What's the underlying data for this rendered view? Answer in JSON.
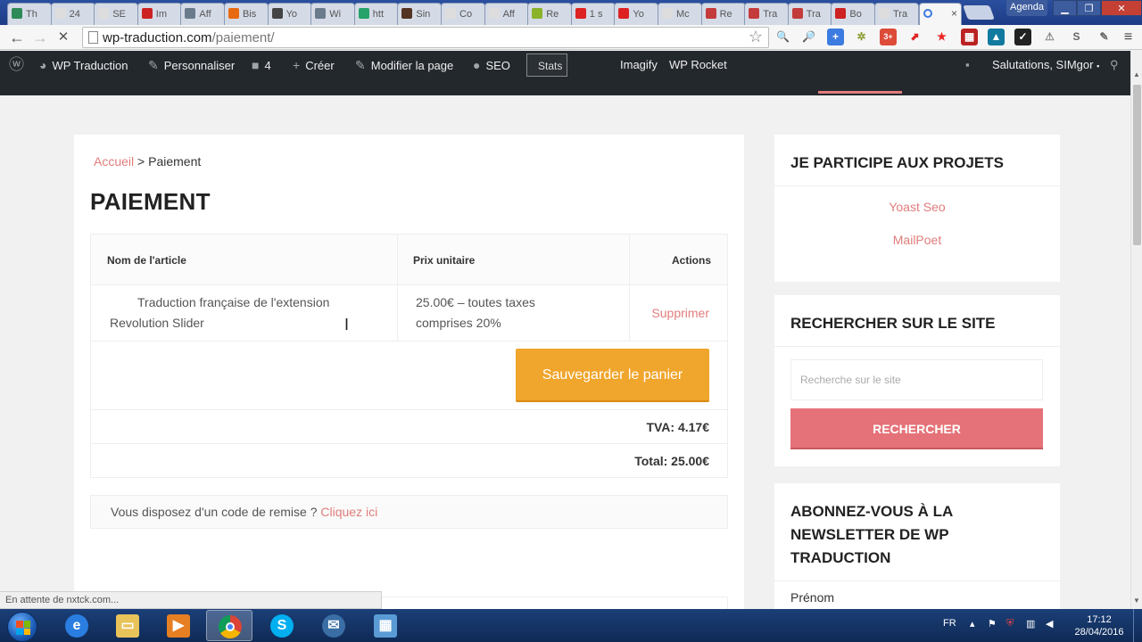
{
  "browser": {
    "tabs": [
      {
        "label": "Th",
        "color": "#2e8b57"
      },
      {
        "label": "24",
        "color": "#dddddd"
      },
      {
        "label": "SE",
        "color": "#dddddd"
      },
      {
        "label": "Im",
        "color": "#cc2222"
      },
      {
        "label": "Aff",
        "color": "#6a7b8c"
      },
      {
        "label": "Bis",
        "color": "#e86a10"
      },
      {
        "label": "Yo",
        "color": "#444444"
      },
      {
        "label": "Wi",
        "color": "#6a7b8c"
      },
      {
        "label": "htt",
        "color": "#25a36a"
      },
      {
        "label": "Sin",
        "color": "#553322"
      },
      {
        "label": "Co",
        "color": "#dddddd"
      },
      {
        "label": "Aff",
        "color": "#dddddd"
      },
      {
        "label": "Re",
        "color": "#8bb32a"
      },
      {
        "label": "1 s",
        "color": "#dd2222"
      },
      {
        "label": "Yo",
        "color": "#dd2222"
      },
      {
        "label": "Mc",
        "color": "#dddddd"
      },
      {
        "label": "Re",
        "color": "#c43b3b"
      },
      {
        "label": "Tra",
        "color": "#c43b3b"
      },
      {
        "label": "Tra",
        "color": "#c43b3b"
      },
      {
        "label": "Bo",
        "color": "#cc2222"
      },
      {
        "label": "Tra",
        "color": "#dddddd"
      }
    ],
    "active_tab_close": "×",
    "agenda_label": "Agenda",
    "url_host": "wp-traduction.com",
    "url_path": "/paiement/",
    "status_text": "En attente de nxtck.com..."
  },
  "adminbar": {
    "site_name": "WP Traduction",
    "customize": "Personnaliser",
    "comments_count": "4",
    "new": "Créer",
    "edit_page": "Modifier la page",
    "seo": "SEO",
    "stats": "Stats",
    "imagify": "Imagify",
    "wp_rocket": "WP Rocket",
    "greeting": "Salutations, SIMgor"
  },
  "main": {
    "breadcrumb_home": "Accueil",
    "breadcrumb_sep": ">",
    "breadcrumb_current": "Paiement",
    "title": "PAIEMENT",
    "cart": {
      "col_article": "Nom de l'article",
      "col_price": "Prix unitaire",
      "col_actions": "Actions",
      "item_name_line1": "Traduction française de l'extension",
      "item_name_line2": "Revolution Slider",
      "item_price_line1": "25.00€ – toutes taxes",
      "item_price_line2": "comprises 20%",
      "remove": "Supprimer",
      "save_cart": "Sauvegarder le panier",
      "vat": "TVA: 4.17€",
      "total": "Total: 25.00€"
    },
    "coupon_text": "Vous disposez d'un code de remise ?",
    "coupon_link": "Cliquez ici"
  },
  "sidebar": {
    "projects_title": "JE PARTICIPE AUX PROJETS",
    "projects": [
      "Yoast Seo",
      "MailPoet"
    ],
    "search_title": "RECHERCHER SUR LE SITE",
    "search_placeholder": "Recherche sur le site",
    "search_button": "RECHERCHER",
    "newsletter_title_line1": "ABONNEZ-VOUS À LA",
    "newsletter_title_line2": "NEWSLETTER DE WP",
    "newsletter_title_line3": "TRADUCTION",
    "newsletter_first_name": "Prénom"
  },
  "taskbar": {
    "lang": "FR",
    "time": "17:12",
    "date": "28/04/2016"
  },
  "colors": {
    "accent": "#e27c7c",
    "save_button": "#f0a52c",
    "search_button": "#e57278",
    "adminbar": "#23282d"
  }
}
